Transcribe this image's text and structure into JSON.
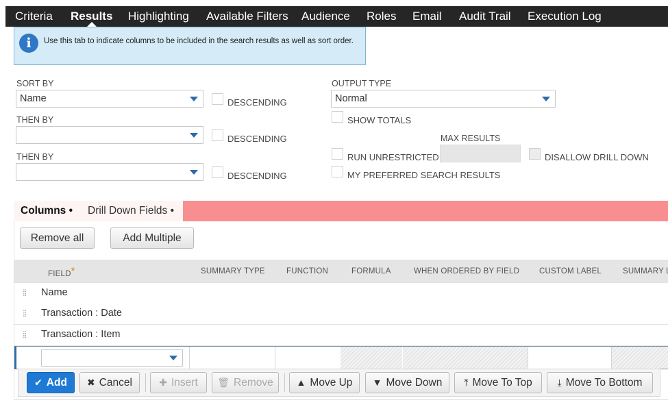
{
  "tabs": [
    {
      "label": "Criteria",
      "active": false
    },
    {
      "label": "Results",
      "active": true
    },
    {
      "label": "Highlighting",
      "active": false
    },
    {
      "label": "Available Filters",
      "active": false
    },
    {
      "label": "Audience",
      "active": false
    },
    {
      "label": "Roles",
      "active": false
    },
    {
      "label": "Email",
      "active": false
    },
    {
      "label": "Audit Trail",
      "active": false
    },
    {
      "label": "Execution Log",
      "active": false
    }
  ],
  "info": {
    "icon": "info-icon",
    "text": "Use this tab to indicate columns to be included in the search results as well as sort order."
  },
  "sort": {
    "sort_by_label": "SORT BY",
    "sort_by_value": "Name",
    "then_by_label_1": "THEN BY",
    "then_by_value_1": "",
    "then_by_label_2": "THEN BY",
    "then_by_value_2": "",
    "descending_label": "DESCENDING"
  },
  "output": {
    "output_type_label": "OUTPUT TYPE",
    "output_type_value": "Normal",
    "show_totals_label": "SHOW TOTALS",
    "max_results_label": "MAX RESULTS",
    "max_results_value": "",
    "run_unrestricted_label": "RUN UNRESTRICTED",
    "disallow_drill_down_label": "DISALLOW DRILL DOWN",
    "preferred_label": "MY PREFERRED SEARCH RESULTS"
  },
  "subtabs": [
    {
      "label": "Columns •",
      "active": true
    },
    {
      "label": "Drill Down Fields •",
      "active": false
    }
  ],
  "toolbar": {
    "remove_all": "Remove all",
    "add_multiple": "Add Multiple"
  },
  "table": {
    "headers": {
      "field": "FIELD",
      "required_mark": "*",
      "summary_type": "SUMMARY TYPE",
      "function": "FUNCTION",
      "formula": "FORMULA",
      "when_ordered": "WHEN ORDERED BY FIELD",
      "custom_label": "CUSTOM LABEL",
      "summary_label": "SUMMARY L"
    },
    "rows": [
      "Name",
      "Transaction : Date",
      "Transaction : Item"
    ],
    "handle_icon": "drag-handle-icon",
    "new_field_value": ""
  },
  "actions": {
    "add": "Add",
    "cancel": "Cancel",
    "insert": "Insert",
    "remove": "Remove",
    "move_up": "Move Up",
    "move_down": "Move Down",
    "move_to_top": "Move To Top",
    "move_to_bottom": "Move To Bottom"
  },
  "colors": {
    "topbar": "#262626",
    "info_bg": "#d5ebf8",
    "subtab_bar": "#f98e91",
    "primary": "#1e7ad4"
  }
}
